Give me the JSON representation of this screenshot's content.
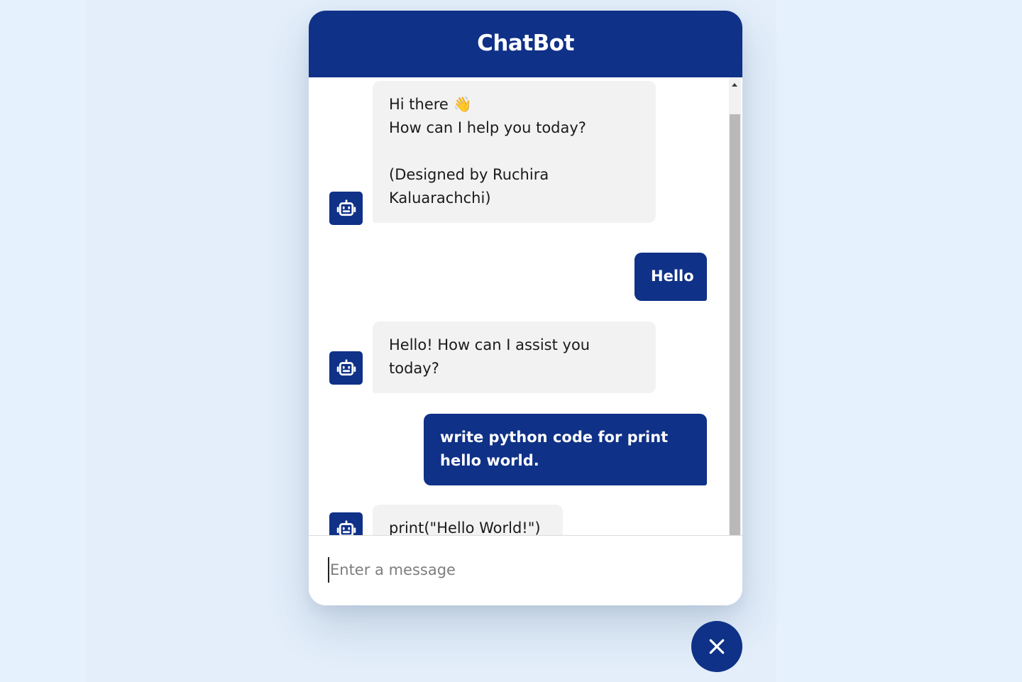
{
  "header": {
    "title": "ChatBot"
  },
  "messages": [
    {
      "role": "incoming",
      "text": "Hi there 👋\nHow can I help you today?\n\n(Designed by Ruchira\nKaluarachchi)",
      "avatar_icon": "robot-icon"
    },
    {
      "role": "outgoing",
      "text": "Hello"
    },
    {
      "role": "incoming",
      "text": "Hello! How can I assist you\ntoday?",
      "avatar_icon": "robot-icon"
    },
    {
      "role": "outgoing",
      "text": "write python code for print\nhello world."
    },
    {
      "role": "incoming",
      "text": "print(\"Hello World!\")",
      "avatar_icon": "robot-icon"
    }
  ],
  "input": {
    "placeholder": "Enter a message",
    "value": ""
  },
  "toggler": {
    "icon": "close-icon"
  },
  "colors": {
    "primary": "#0f3187",
    "incoming_bubble": "#f2f2f2",
    "page_background": "#e3eefa"
  }
}
